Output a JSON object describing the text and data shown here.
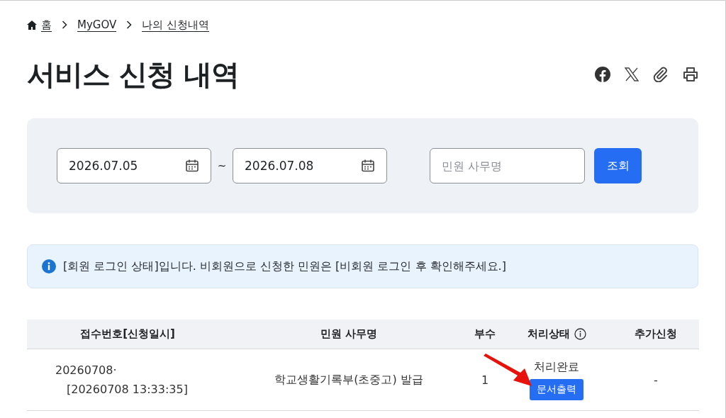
{
  "breadcrumb": [
    {
      "label": "홈",
      "kind": "home"
    },
    {
      "label": "MyGOV",
      "kind": "link"
    },
    {
      "label": "나의 신청내역",
      "kind": "link"
    }
  ],
  "title": "서비스 신청 내역",
  "share_icons": [
    {
      "kind": "facebook"
    },
    {
      "kind": "x"
    },
    {
      "kind": "attach"
    },
    {
      "kind": "print"
    }
  ],
  "filter": {
    "start_date": "2026.07.05",
    "separator": "~",
    "end_date": "2026.07.08",
    "name_placeholder": "민원 사무명",
    "search_button": "조회"
  },
  "notice": "[회원 로그인 상태]입니다. 비회원으로 신청한 민원은 [비회원 로그인 후 확인해주세요.]",
  "table": {
    "columns": [
      {
        "label": "접수번호[신청일시]",
        "info_icon": false
      },
      {
        "label": "민원 사무명",
        "info_icon": false
      },
      {
        "label": "부수",
        "info_icon": false
      },
      {
        "label": "처리상태",
        "info_icon": true
      },
      {
        "label": "추가신청",
        "info_icon": false
      }
    ],
    "rows": [
      {
        "receipt": "20260708·\n[20260708 13:33:35]",
        "name": "학교생활기록부(초중고) 발급",
        "copies": "1",
        "status": "처리완료",
        "action_button": "문서출력",
        "extra": "-"
      }
    ]
  }
}
